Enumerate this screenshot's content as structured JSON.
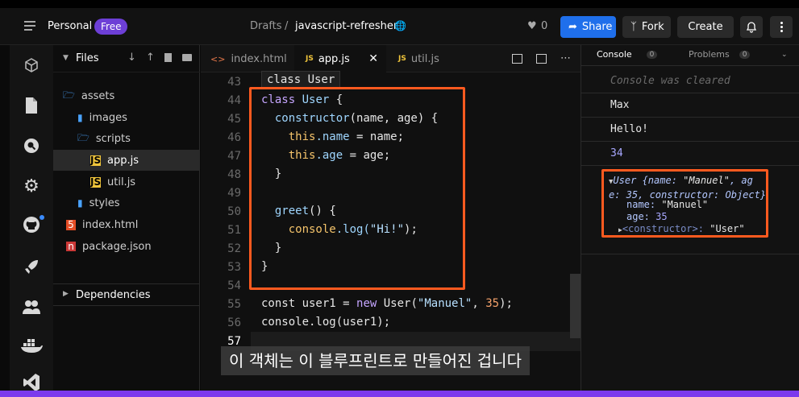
{
  "topbar": {
    "workspace": "Personal",
    "plan_badge": "Free",
    "breadcrumb_root": "Drafts",
    "breadcrumb_sep": "/",
    "project_name": "javascript-refresher",
    "likes": "0",
    "share_label": "Share",
    "fork_label": "Fork",
    "create_label": "Create"
  },
  "files_panel": {
    "title": "Files",
    "items": [
      {
        "label": "assets",
        "type": "folder-open"
      },
      {
        "label": "images",
        "type": "folder"
      },
      {
        "label": "scripts",
        "type": "folder-open"
      },
      {
        "label": "app.js",
        "type": "js"
      },
      {
        "label": "util.js",
        "type": "js"
      },
      {
        "label": "styles",
        "type": "folder"
      },
      {
        "label": "index.html",
        "type": "html"
      },
      {
        "label": "package.json",
        "type": "npm"
      }
    ],
    "dependencies_label": "Dependencies"
  },
  "editor": {
    "tabs": [
      {
        "label": "index.html",
        "icon": "code-icon"
      },
      {
        "label": "app.js",
        "icon": "JS"
      },
      {
        "label": "util.js",
        "icon": "JS"
      }
    ],
    "tooltip": "class User",
    "line_numbers": [
      "43",
      "44",
      "45",
      "46",
      "47",
      "48",
      "49",
      "50",
      "51",
      "52",
      "53",
      "54",
      "55",
      "56",
      "57"
    ],
    "code": {
      "l44a": "class",
      "l44b": "User",
      "l44c": "{",
      "l45a": "constructor",
      "l45b": "(name, age)",
      "l45c": "{",
      "l46a": "this",
      "l46b": ".name",
      "l46c": "= name;",
      "l47a": "this",
      "l47b": ".age",
      "l47c": "= age;",
      "l48": "}",
      "l50a": "greet",
      "l50b": "()",
      "l50c": "{",
      "l51a": "console",
      "l51b": ".log(",
      "l51c": "\"Hi!\"",
      "l51d": ");",
      "l52": "}",
      "l53": "}",
      "l55a": "const user1 =",
      "l55b": "new",
      "l55c": "User(",
      "l55d": "\"Manuel\"",
      "l55e": ",",
      "l55f": "35",
      "l55g": ");",
      "l56": "console.log(user1);"
    },
    "subtitle": "이 객체는 이 블루프린트로 만들어진 겁니다"
  },
  "console_panel": {
    "tab_console": "Console",
    "console_count": "0",
    "tab_problems": "Problems",
    "problems_count": "0",
    "cleared": "Console was cleared",
    "outputs": [
      "Max",
      "Hello!",
      "34"
    ],
    "object": {
      "head_a": "User {",
      "head_b": "name",
      "head_c": ": ",
      "head_d": "\"Manuel\"",
      "head_e": ", ag",
      "head_f": "e: 35, constructor: Object}",
      "name_key": "name:",
      "name_val": "\"Manuel\"",
      "age_key": "age:",
      "age_val": "35",
      "ctor_key": "<constructor>:",
      "ctor_val": "\"User\""
    }
  },
  "colors": {
    "accent_blue": "#1f6feb",
    "highlight_orange": "#ff5a1f",
    "purple": "#7c3aed"
  }
}
